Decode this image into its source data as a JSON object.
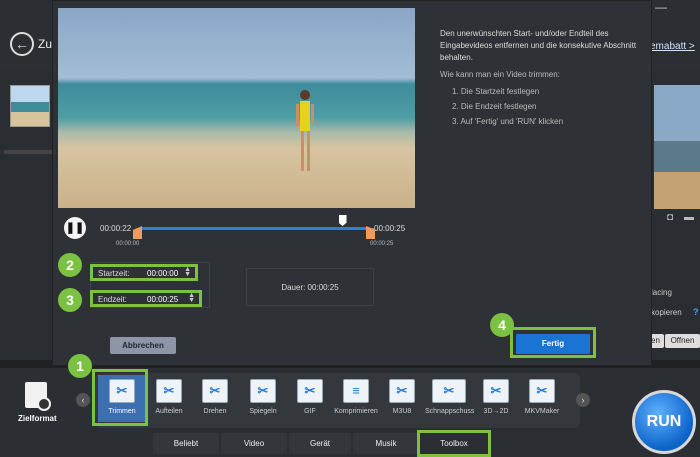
{
  "background": {
    "back_label": "Zur",
    "top_link": "emabatt >",
    "top_button": "—",
    "right_text_1": "lacing",
    "right_text_2": "kopieren",
    "right_help": "?",
    "btn_lesen": "sen",
    "btn_oeffnen": "Offnen"
  },
  "dialog": {
    "time_current": "00:00:22",
    "time_total": "00:00:25",
    "time_range_start": "00:00:00",
    "time_range_end": "00:00:25",
    "startzeit_label": "Startzeit:",
    "startzeit_value": "00:00:00",
    "endzeit_label": "Endzeit:",
    "endzeit_value": "00:00:25",
    "duration": "Dauer:  00:00:25",
    "intro": "Den unerwünschten Start- und/oder Endteil des Eingabevideos entfernen und die konsekutive Abschnitt behalten.",
    "question": "Wie kann man ein Video trimmen:",
    "steps": [
      "1. Die Startzeit festlegen",
      "2. Die Endzeit festlegen",
      "3. Auf 'Fertig' und 'RUN' klicken"
    ],
    "cancel_label": "Abbrechen",
    "done_label": "Fertig",
    "progress_fraction": 0.88
  },
  "badges": [
    "1",
    "2",
    "3",
    "4"
  ],
  "toolbar": {
    "zielformat": "Zielformat",
    "tools": [
      {
        "label": "Trimmen",
        "icon": "scissors-icon"
      },
      {
        "label": "Aufteilen",
        "icon": "split-icon"
      },
      {
        "label": "Drehen",
        "icon": "rotate-icon"
      },
      {
        "label": "Spiegeln",
        "icon": "mirror-icon"
      },
      {
        "label": "GIF",
        "icon": "gif-icon"
      },
      {
        "label": "Komprimieren",
        "icon": "compress-icon"
      },
      {
        "label": "M3U8",
        "icon": "m3u8-icon"
      },
      {
        "label": "Schnappschuss",
        "icon": "snapshot-icon"
      },
      {
        "label": "3D→2D",
        "icon": "3d-icon"
      },
      {
        "label": "MKVMaker",
        "icon": "mkv-icon"
      }
    ],
    "tabs": [
      "Beliebt",
      "Video",
      "Gerät",
      "Musik",
      "Toolbox"
    ],
    "run": "RUN"
  }
}
